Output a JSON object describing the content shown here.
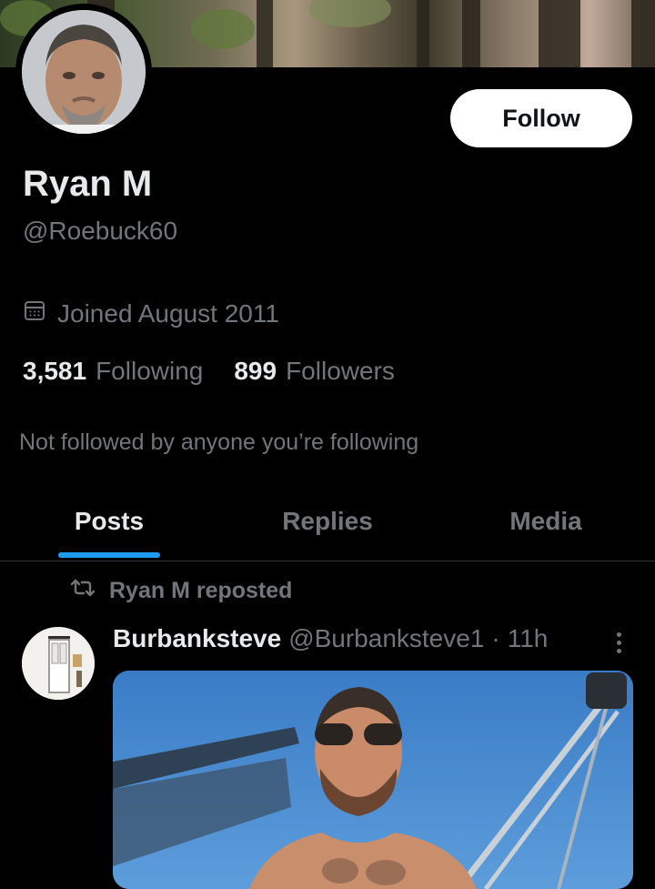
{
  "profile": {
    "name": "Ryan M",
    "handle": "@Roebuck60",
    "joined": "Joined August 2011",
    "following_count": "3,581",
    "following_label": "Following",
    "followers_count": "899",
    "followers_label": "Followers",
    "mutuals_note": "Not followed by anyone you’re following"
  },
  "actions": {
    "follow_label": "Follow"
  },
  "tabs": [
    {
      "label": "Posts",
      "active": true
    },
    {
      "label": "Replies",
      "active": false
    },
    {
      "label": "Media",
      "active": false
    }
  ],
  "post": {
    "repost_note": "Ryan M reposted",
    "author_name": "Burbanksteve",
    "author_handle": "@Burbanksteve1",
    "separator": "·",
    "time": "11h"
  },
  "icons": {
    "calendar": "calendar-icon",
    "repost": "repost-icon",
    "more": "more-vertical-icon"
  },
  "colors": {
    "background": "#000000",
    "primary_text": "#e7e9ea",
    "secondary_text": "#71767b",
    "accent": "#1d9bf0",
    "follow_button_bg": "#ffffff"
  }
}
